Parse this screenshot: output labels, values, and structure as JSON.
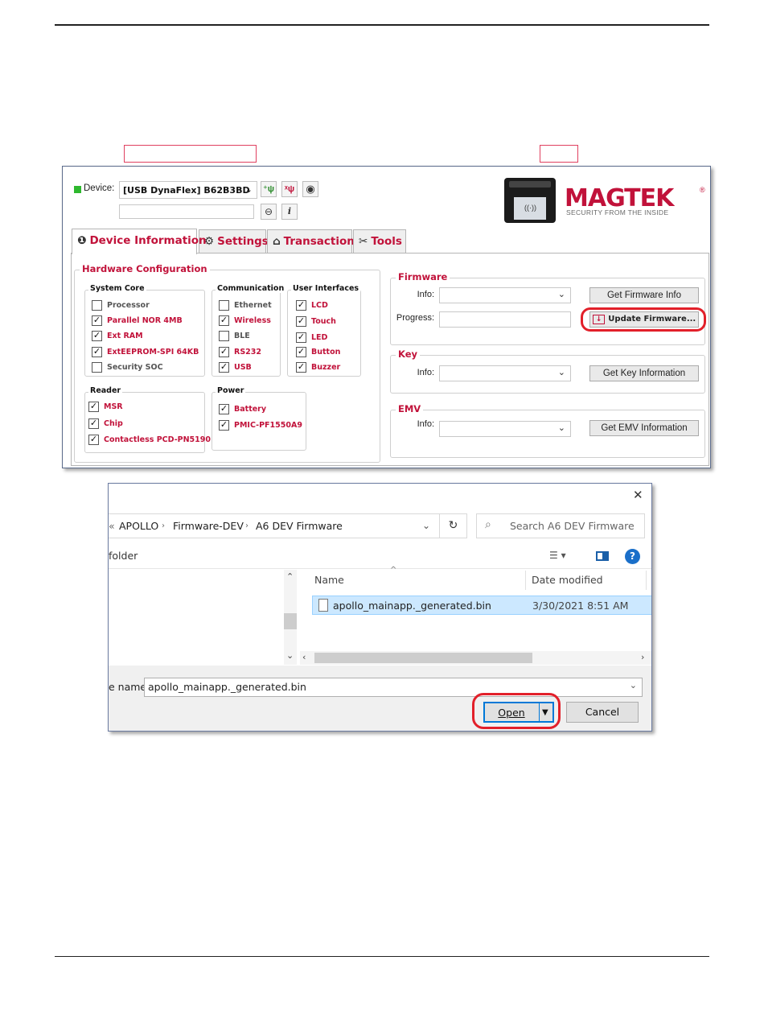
{
  "app": {
    "device_label": "Device:",
    "device_value": "[USB DynaFlex] B62B3BD",
    "device_status_color": "#2eb82e",
    "brand_name": "MAGTEK",
    "brand_tagline": "SECURITY FROM THE INSIDE",
    "brand_color": "#c1123a",
    "tabs": [
      {
        "label": "Device Information",
        "icon": "info-icon"
      },
      {
        "label": "Settings",
        "icon": "gear-icon"
      },
      {
        "label": "Transaction",
        "icon": "transaction-icon"
      },
      {
        "label": "Tools",
        "icon": "tools-icon"
      }
    ],
    "hardware": {
      "title": "Hardware Configuration",
      "system_core": {
        "title": "System Core",
        "items": [
          {
            "label": "Processor",
            "checked": false
          },
          {
            "label": "Parallel NOR 4MB",
            "checked": true
          },
          {
            "label": "Ext RAM",
            "checked": true
          },
          {
            "label": "ExtEEPROM-SPI 64KB",
            "checked": true
          },
          {
            "label": "Security SOC",
            "checked": false
          }
        ]
      },
      "communication": {
        "title": "Communication",
        "items": [
          {
            "label": "Ethernet",
            "checked": false
          },
          {
            "label": "Wireless",
            "checked": true
          },
          {
            "label": "BLE",
            "checked": false
          },
          {
            "label": "RS232",
            "checked": true
          },
          {
            "label": "USB",
            "checked": true
          }
        ]
      },
      "user_interfaces": {
        "title": "User Interfaces",
        "items": [
          {
            "label": "LCD",
            "checked": true
          },
          {
            "label": "Touch",
            "checked": true
          },
          {
            "label": "LED",
            "checked": true
          },
          {
            "label": "Button",
            "checked": true
          },
          {
            "label": "Buzzer",
            "checked": true
          }
        ]
      },
      "reader": {
        "title": "Reader",
        "items": [
          {
            "label": "MSR",
            "checked": true
          },
          {
            "label": "Chip",
            "checked": true
          },
          {
            "label": "Contactless PCD-PN5190",
            "checked": true
          }
        ]
      },
      "power": {
        "title": "Power",
        "items": [
          {
            "label": "Battery",
            "checked": true
          },
          {
            "label": "PMIC-PF1550A9",
            "checked": true
          }
        ]
      }
    },
    "firmware": {
      "title": "Firmware",
      "info_label": "Info:",
      "progress_label": "Progress:",
      "get_info_button": "Get Firmware Info",
      "update_button": "Update Firmware..."
    },
    "key": {
      "title": "Key",
      "info_label": "Info:",
      "get_button": "Get Key Information"
    },
    "emv": {
      "title": "EMV",
      "info_label": "Info:",
      "get_button": "Get EMV Information"
    },
    "tool_icons": [
      "plug-add-icon",
      "plug-remove-icon",
      "refresh-device-icon",
      "zoom-icon",
      "info-icon"
    ]
  },
  "dialog": {
    "close_glyph": "✕",
    "breadcrumb": [
      "«",
      "APOLLO",
      "Firmware-DEV",
      "A6 DEV Firmware"
    ],
    "search_placeholder": "Search A6 DEV Firmware",
    "new_folder_label": "folder",
    "columns": {
      "name": "Name",
      "date_modified": "Date modified"
    },
    "files": [
      {
        "name": "apollo_mainapp._generated.bin",
        "date": "3/30/2021 8:51 AM",
        "selected": true
      }
    ],
    "filename_label": "e name:",
    "filename_value": "apollo_mainapp._generated.bin",
    "open_button": "Open",
    "cancel_button": "Cancel"
  },
  "annotation_color": "#e2202a"
}
